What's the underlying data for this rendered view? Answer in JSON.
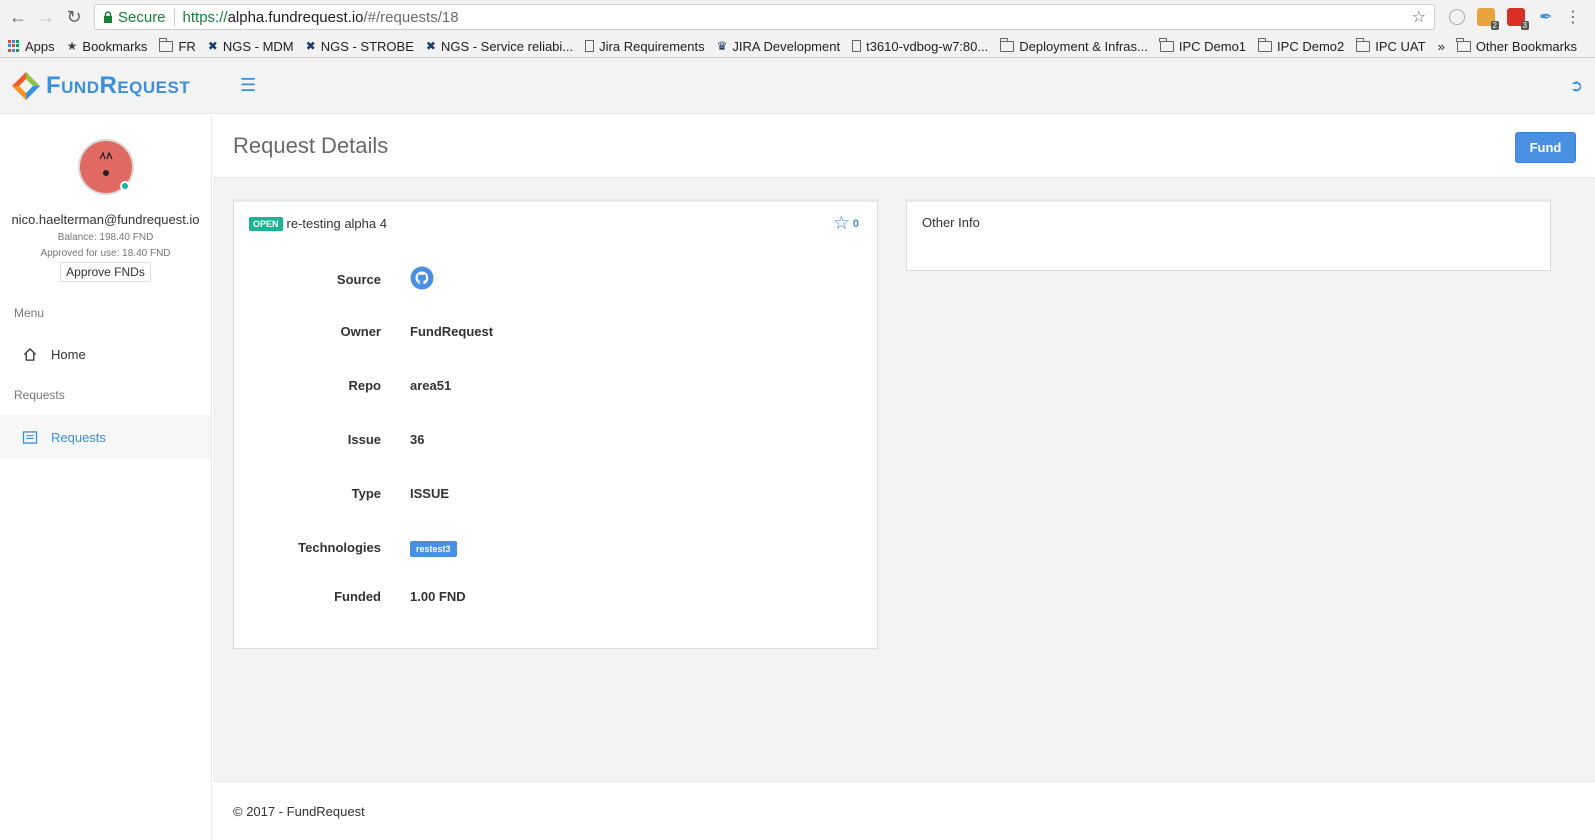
{
  "browser": {
    "secure_label": "Secure",
    "url_scheme": "https://",
    "url_host": "alpha.fundrequest.io",
    "url_path": "/#/requests/18",
    "ext_badges": [
      "2",
      "3"
    ],
    "bookmarks": [
      {
        "label": "Apps",
        "icon": "apps-grid"
      },
      {
        "label": "Bookmarks",
        "icon": "star"
      },
      {
        "label": "FR",
        "icon": "folder"
      },
      {
        "label": "NGS - MDM",
        "icon": "tools"
      },
      {
        "label": "NGS - STROBE",
        "icon": "tools"
      },
      {
        "label": "NGS - Service reliabi...",
        "icon": "tools"
      },
      {
        "label": "Jira Requirements",
        "icon": "doc"
      },
      {
        "label": "JIRA Development",
        "icon": "jira"
      },
      {
        "label": "t3610-vdbog-w7:80...",
        "icon": "doc"
      },
      {
        "label": "Deployment & Infras...",
        "icon": "folder"
      },
      {
        "label": "IPC Demo1",
        "icon": "folder"
      },
      {
        "label": "IPC Demo2",
        "icon": "folder"
      },
      {
        "label": "IPC UAT",
        "icon": "folder"
      }
    ],
    "overflow": "»",
    "other_bookmarks": "Other Bookmarks"
  },
  "header": {
    "logo_text": "FundRequest",
    "menu_icon": "hamburger-icon",
    "logout_icon": "sign-out-icon"
  },
  "sidebar": {
    "email": "nico.haelterman@fundrequest.io",
    "balance": "Balance: 198.40 FND",
    "approved": "Approved for use: 18.40 FND",
    "approve_button": "Approve FNDs",
    "menu_heading": "Menu",
    "home_label": "Home",
    "requests_heading": "Requests",
    "requests_label": "Requests"
  },
  "page": {
    "title": "Request Details",
    "fund_button": "Fund"
  },
  "request": {
    "status": "OPEN",
    "title": "re-testing alpha 4",
    "star_count": "0",
    "fields": {
      "source_label": "Source",
      "owner_label": "Owner",
      "owner": "FundRequest",
      "repo_label": "Repo",
      "repo": "area51",
      "issue_label": "Issue",
      "issue": "36",
      "type_label": "Type",
      "type": "ISSUE",
      "technologies_label": "Technologies",
      "technologies": [
        "restest3"
      ],
      "funded_label": "Funded",
      "funded": "1.00 FND"
    }
  },
  "other_info": {
    "title": "Other Info"
  },
  "footer": {
    "text": "© 2017 - FundRequest"
  },
  "colors": {
    "accent": "#3a8fde",
    "status_open": "#1ab394",
    "fund_button": "#4a90e2"
  }
}
